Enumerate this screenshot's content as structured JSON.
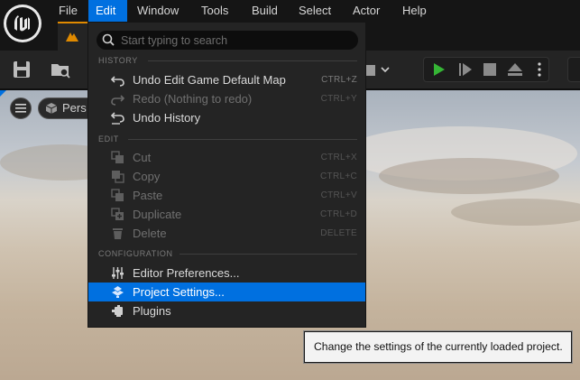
{
  "menubar": {
    "items": [
      "File",
      "Edit",
      "Window",
      "Tools",
      "Build",
      "Select",
      "Actor",
      "Help"
    ],
    "active": "Edit"
  },
  "viewport": {
    "perspective_label": "Pers"
  },
  "dropdown": {
    "search_placeholder": "Start typing to search",
    "sections": {
      "history": "HISTORY",
      "edit": "EDIT",
      "configuration": "CONFIGURATION"
    },
    "items": [
      {
        "label": "Undo Edit Game Default Map",
        "shortcut": "CTRL+Z",
        "icon": "undo-icon",
        "enabled": true
      },
      {
        "label": "Redo (Nothing to redo)",
        "shortcut": "CTRL+Y",
        "icon": "redo-icon",
        "enabled": false
      },
      {
        "label": "Undo History",
        "shortcut": "",
        "icon": "undo-history-icon",
        "enabled": true
      },
      {
        "label": "Cut",
        "shortcut": "CTRL+X",
        "icon": "cut-icon",
        "enabled": false
      },
      {
        "label": "Copy",
        "shortcut": "CTRL+C",
        "icon": "copy-icon",
        "enabled": false
      },
      {
        "label": "Paste",
        "shortcut": "CTRL+V",
        "icon": "paste-icon",
        "enabled": false
      },
      {
        "label": "Duplicate",
        "shortcut": "CTRL+D",
        "icon": "duplicate-icon",
        "enabled": false
      },
      {
        "label": "Delete",
        "shortcut": "DELETE",
        "icon": "trash-icon",
        "enabled": false
      },
      {
        "label": "Editor Preferences...",
        "shortcut": "",
        "icon": "sliders-icon",
        "enabled": true
      },
      {
        "label": "Project Settings...",
        "shortcut": "",
        "icon": "project-settings-icon",
        "enabled": true,
        "highlighted": true
      },
      {
        "label": "Plugins",
        "shortcut": "",
        "icon": "plugin-icon",
        "enabled": true
      }
    ]
  },
  "tooltip": {
    "text": "Change the settings of the currently loaded project."
  },
  "colors": {
    "accent": "#0070e0",
    "menu_bg": "#242424",
    "play_green": "#35b535",
    "level_tab_orange": "#e08a00"
  }
}
